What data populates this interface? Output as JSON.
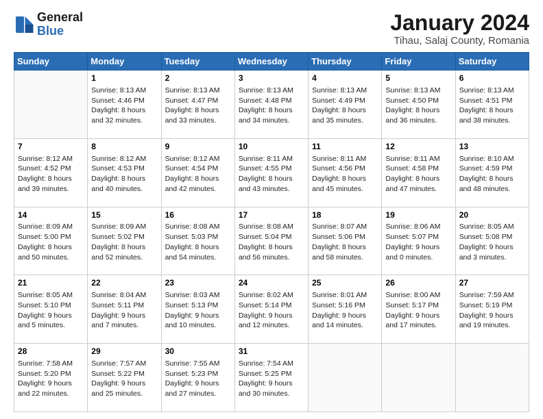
{
  "logo": {
    "line1": "General",
    "line2": "Blue"
  },
  "title": "January 2024",
  "subtitle": "Tihau, Salaj County, Romania",
  "header_days": [
    "Sunday",
    "Monday",
    "Tuesday",
    "Wednesday",
    "Thursday",
    "Friday",
    "Saturday"
  ],
  "weeks": [
    [
      {
        "day": "",
        "sunrise": "",
        "sunset": "",
        "daylight": ""
      },
      {
        "day": "1",
        "sunrise": "Sunrise: 8:13 AM",
        "sunset": "Sunset: 4:46 PM",
        "daylight": "Daylight: 8 hours and 32 minutes."
      },
      {
        "day": "2",
        "sunrise": "Sunrise: 8:13 AM",
        "sunset": "Sunset: 4:47 PM",
        "daylight": "Daylight: 8 hours and 33 minutes."
      },
      {
        "day": "3",
        "sunrise": "Sunrise: 8:13 AM",
        "sunset": "Sunset: 4:48 PM",
        "daylight": "Daylight: 8 hours and 34 minutes."
      },
      {
        "day": "4",
        "sunrise": "Sunrise: 8:13 AM",
        "sunset": "Sunset: 4:49 PM",
        "daylight": "Daylight: 8 hours and 35 minutes."
      },
      {
        "day": "5",
        "sunrise": "Sunrise: 8:13 AM",
        "sunset": "Sunset: 4:50 PM",
        "daylight": "Daylight: 8 hours and 36 minutes."
      },
      {
        "day": "6",
        "sunrise": "Sunrise: 8:13 AM",
        "sunset": "Sunset: 4:51 PM",
        "daylight": "Daylight: 8 hours and 38 minutes."
      }
    ],
    [
      {
        "day": "7",
        "sunrise": "Sunrise: 8:12 AM",
        "sunset": "Sunset: 4:52 PM",
        "daylight": "Daylight: 8 hours and 39 minutes."
      },
      {
        "day": "8",
        "sunrise": "Sunrise: 8:12 AM",
        "sunset": "Sunset: 4:53 PM",
        "daylight": "Daylight: 8 hours and 40 minutes."
      },
      {
        "day": "9",
        "sunrise": "Sunrise: 8:12 AM",
        "sunset": "Sunset: 4:54 PM",
        "daylight": "Daylight: 8 hours and 42 minutes."
      },
      {
        "day": "10",
        "sunrise": "Sunrise: 8:11 AM",
        "sunset": "Sunset: 4:55 PM",
        "daylight": "Daylight: 8 hours and 43 minutes."
      },
      {
        "day": "11",
        "sunrise": "Sunrise: 8:11 AM",
        "sunset": "Sunset: 4:56 PM",
        "daylight": "Daylight: 8 hours and 45 minutes."
      },
      {
        "day": "12",
        "sunrise": "Sunrise: 8:11 AM",
        "sunset": "Sunset: 4:58 PM",
        "daylight": "Daylight: 8 hours and 47 minutes."
      },
      {
        "day": "13",
        "sunrise": "Sunrise: 8:10 AM",
        "sunset": "Sunset: 4:59 PM",
        "daylight": "Daylight: 8 hours and 48 minutes."
      }
    ],
    [
      {
        "day": "14",
        "sunrise": "Sunrise: 8:09 AM",
        "sunset": "Sunset: 5:00 PM",
        "daylight": "Daylight: 8 hours and 50 minutes."
      },
      {
        "day": "15",
        "sunrise": "Sunrise: 8:09 AM",
        "sunset": "Sunset: 5:02 PM",
        "daylight": "Daylight: 8 hours and 52 minutes."
      },
      {
        "day": "16",
        "sunrise": "Sunrise: 8:08 AM",
        "sunset": "Sunset: 5:03 PM",
        "daylight": "Daylight: 8 hours and 54 minutes."
      },
      {
        "day": "17",
        "sunrise": "Sunrise: 8:08 AM",
        "sunset": "Sunset: 5:04 PM",
        "daylight": "Daylight: 8 hours and 56 minutes."
      },
      {
        "day": "18",
        "sunrise": "Sunrise: 8:07 AM",
        "sunset": "Sunset: 5:06 PM",
        "daylight": "Daylight: 8 hours and 58 minutes."
      },
      {
        "day": "19",
        "sunrise": "Sunrise: 8:06 AM",
        "sunset": "Sunset: 5:07 PM",
        "daylight": "Daylight: 9 hours and 0 minutes."
      },
      {
        "day": "20",
        "sunrise": "Sunrise: 8:05 AM",
        "sunset": "Sunset: 5:08 PM",
        "daylight": "Daylight: 9 hours and 3 minutes."
      }
    ],
    [
      {
        "day": "21",
        "sunrise": "Sunrise: 8:05 AM",
        "sunset": "Sunset: 5:10 PM",
        "daylight": "Daylight: 9 hours and 5 minutes."
      },
      {
        "day": "22",
        "sunrise": "Sunrise: 8:04 AM",
        "sunset": "Sunset: 5:11 PM",
        "daylight": "Daylight: 9 hours and 7 minutes."
      },
      {
        "day": "23",
        "sunrise": "Sunrise: 8:03 AM",
        "sunset": "Sunset: 5:13 PM",
        "daylight": "Daylight: 9 hours and 10 minutes."
      },
      {
        "day": "24",
        "sunrise": "Sunrise: 8:02 AM",
        "sunset": "Sunset: 5:14 PM",
        "daylight": "Daylight: 9 hours and 12 minutes."
      },
      {
        "day": "25",
        "sunrise": "Sunrise: 8:01 AM",
        "sunset": "Sunset: 5:16 PM",
        "daylight": "Daylight: 9 hours and 14 minutes."
      },
      {
        "day": "26",
        "sunrise": "Sunrise: 8:00 AM",
        "sunset": "Sunset: 5:17 PM",
        "daylight": "Daylight: 9 hours and 17 minutes."
      },
      {
        "day": "27",
        "sunrise": "Sunrise: 7:59 AM",
        "sunset": "Sunset: 5:19 PM",
        "daylight": "Daylight: 9 hours and 19 minutes."
      }
    ],
    [
      {
        "day": "28",
        "sunrise": "Sunrise: 7:58 AM",
        "sunset": "Sunset: 5:20 PM",
        "daylight": "Daylight: 9 hours and 22 minutes."
      },
      {
        "day": "29",
        "sunrise": "Sunrise: 7:57 AM",
        "sunset": "Sunset: 5:22 PM",
        "daylight": "Daylight: 9 hours and 25 minutes."
      },
      {
        "day": "30",
        "sunrise": "Sunrise: 7:55 AM",
        "sunset": "Sunset: 5:23 PM",
        "daylight": "Daylight: 9 hours and 27 minutes."
      },
      {
        "day": "31",
        "sunrise": "Sunrise: 7:54 AM",
        "sunset": "Sunset: 5:25 PM",
        "daylight": "Daylight: 9 hours and 30 minutes."
      },
      {
        "day": "",
        "sunrise": "",
        "sunset": "",
        "daylight": ""
      },
      {
        "day": "",
        "sunrise": "",
        "sunset": "",
        "daylight": ""
      },
      {
        "day": "",
        "sunrise": "",
        "sunset": "",
        "daylight": ""
      }
    ]
  ]
}
